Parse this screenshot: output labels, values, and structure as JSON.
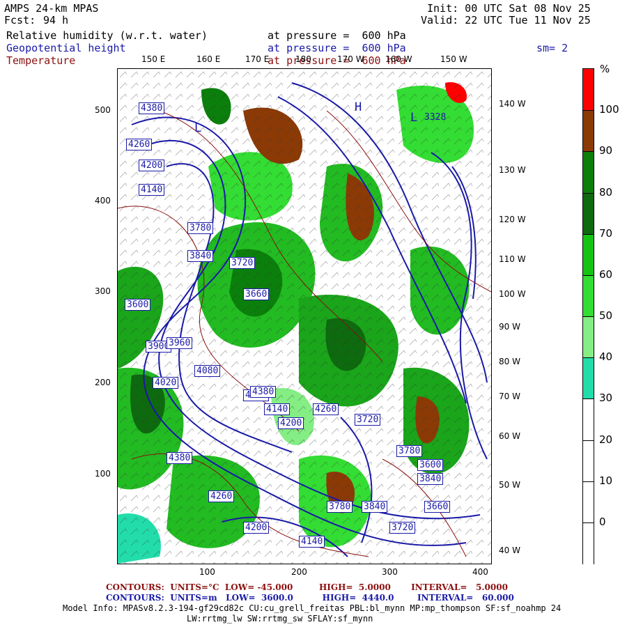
{
  "header": {
    "model": "AMPS 24-km MPAS",
    "fcst_label": "Fcst:",
    "fcst_value": "94 h",
    "init": "Init: 00 UTC Sat 08 Nov 25",
    "valid": "Valid: 22 UTC Tue 11 Nov 25",
    "smoothing": "sm= 2"
  },
  "fields": [
    {
      "name": "Relative humidity (w.r.t. water)",
      "level": "at pressure =  600 hPa",
      "color": "#000000"
    },
    {
      "name": "Geopotential height",
      "level": "at pressure =  600 hPa",
      "color": "#1a1aa8"
    },
    {
      "name": "Temperature",
      "level": "at pressure =  600 hPa",
      "color": "#8b1010"
    }
  ],
  "axes": {
    "y_ticks": [
      "500",
      "400",
      "300",
      "200",
      "100"
    ],
    "x_ticks": [
      "100",
      "200",
      "300",
      "400"
    ],
    "top_lon": [
      "150 E",
      "160 E",
      "170 E",
      "180",
      "170 W",
      "160 W",
      "150 W"
    ],
    "right_lon": [
      "140 W",
      "130 W",
      "120 W",
      "110 W",
      "100 W",
      "90 W",
      "80 W",
      "70 W",
      "60 W",
      "50 W",
      "40 W"
    ]
  },
  "colorbar": {
    "unit": "%",
    "labels": [
      "100",
      "90",
      "80",
      "70",
      "60",
      "50",
      "40",
      "30",
      "20",
      "10",
      "0"
    ],
    "colors": [
      "#ff0000",
      "#8b3a06",
      "#0b7f0b",
      "#0e6a0e",
      "#13c413",
      "#33dd33",
      "#84ee84",
      "#22ddaa",
      "#ffffff",
      "#ffffff",
      "#ffffff",
      "#ffffff"
    ]
  },
  "map_labels": {
    "heights": [
      "4380",
      "4260",
      "4200",
      "4140",
      "3780",
      "3840",
      "3720",
      "3660",
      "3600",
      "3900",
      "3960",
      "4020",
      "4080",
      "4320",
      "4380",
      "4140",
      "4200",
      "4260",
      "3720",
      "3780",
      "3840"
    ],
    "extrema": [
      "H",
      "L",
      "L"
    ],
    "low_value": "3328"
  },
  "footer": {
    "temp_contours": "CONTOURS:  UNITS=°C  LOW= -45.000         HIGH=  5.0000       INTERVAL=   5.0000",
    "height_contours": "CONTOURS:  UNITS=m   LOW=  3600.0          HIGH=  4440.0        INTERVAL=   60.000",
    "model_info": "Model Info: MPASv8.2.3-194-gf29cd82c CU:cu_grell_freitas PBL:bl_mynn MP:mp_thompson SF:sf_noahmp 24",
    "model_info2": "LW:rrtmg_lw SW:rrtmg_sw SFLAY:sf_mynn"
  }
}
